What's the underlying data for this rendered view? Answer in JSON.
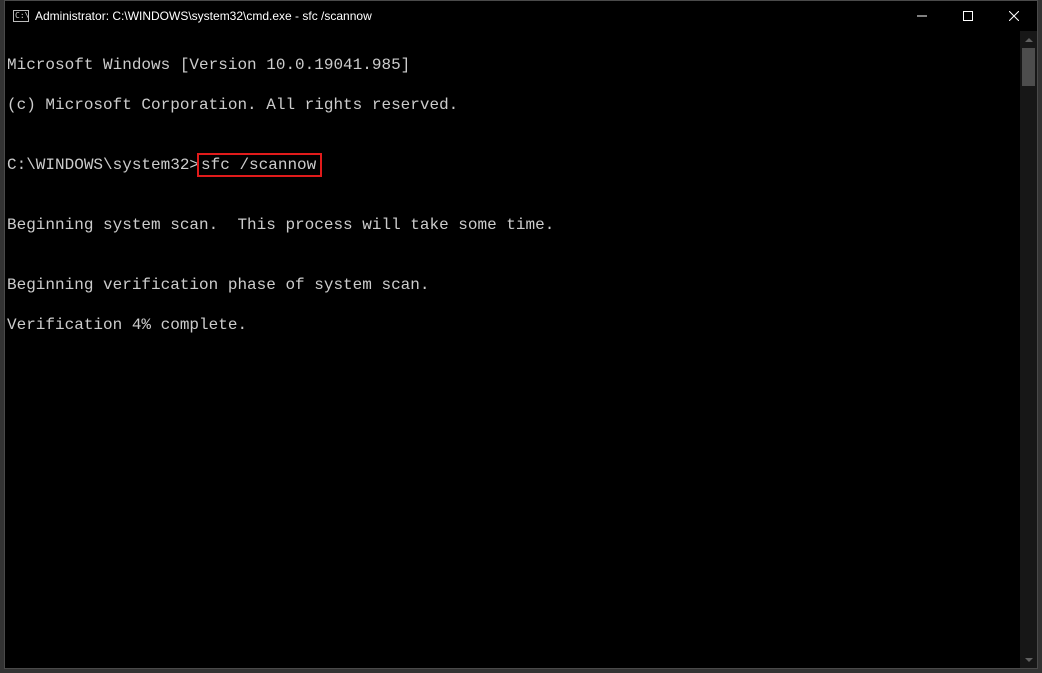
{
  "window": {
    "title": "Administrator: C:\\WINDOWS\\system32\\cmd.exe - sfc  /scannow"
  },
  "console": {
    "line1": "Microsoft Windows [Version 10.0.19041.985]",
    "line2": "(c) Microsoft Corporation. All rights reserved.",
    "blank1": "",
    "prompt": "C:\\WINDOWS\\system32>",
    "command": "sfc /scannow",
    "blank2": "",
    "line5": "Beginning system scan.  This process will take some time.",
    "blank3": "",
    "line7": "Beginning verification phase of system scan.",
    "line8": "Verification 4% complete."
  },
  "highlight": {
    "color": "#e11b1b"
  }
}
